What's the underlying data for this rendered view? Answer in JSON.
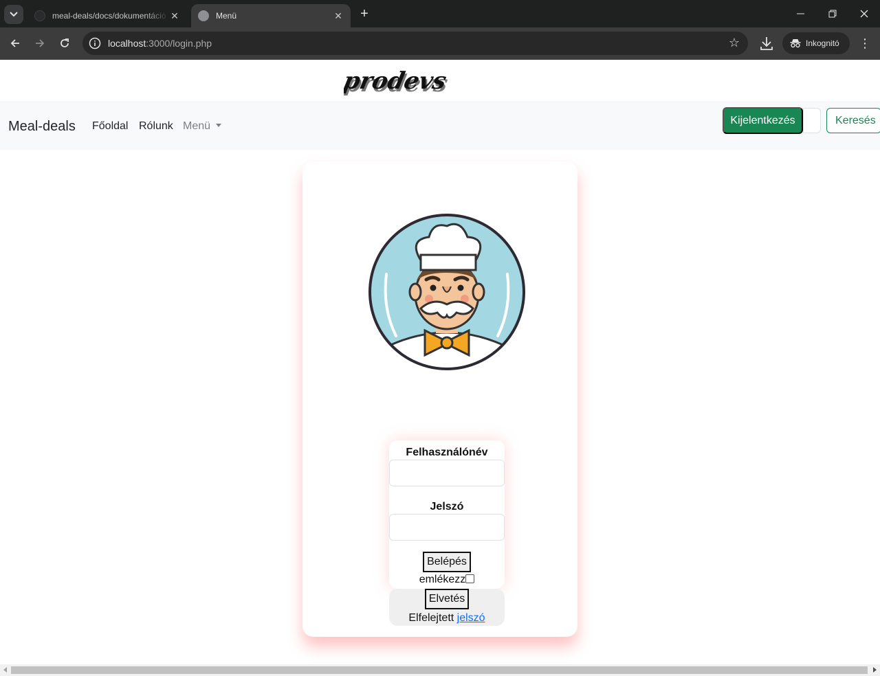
{
  "browser": {
    "tabs": [
      {
        "title": "meal-deals/docs/dokumentáció",
        "active": false,
        "close": "✕"
      },
      {
        "title": "Menü",
        "active": true,
        "close": "✕"
      }
    ],
    "new_tab": "+",
    "window_controls": {
      "minimize": "—",
      "restore": "❐",
      "close": "✕"
    },
    "address": {
      "host": "localhost",
      "path": ":3000/login.php"
    },
    "incognito_label": "Inkognitó",
    "icons": [
      "tab-list-icon",
      "back-icon",
      "forward-icon",
      "reload-icon",
      "site-info-icon",
      "bookmark-star-icon",
      "download-icon",
      "incognito-icon",
      "menu-kebab-icon"
    ]
  },
  "page": {
    "logo_text": "prodevs",
    "navbar": {
      "brand": "Meal-deals",
      "links": [
        "Főoldal",
        "Rólunk"
      ],
      "dropdown_label": "Menü",
      "logout_label": "Kijelentkezés",
      "search_value": "",
      "search_label": "Keresés"
    },
    "login": {
      "username_label": "Felhasználónév",
      "username_value": "",
      "password_label": "Jelszó",
      "password_value": "",
      "submit_label": "Belépés",
      "remember_label": "emlékezz",
      "remember_checked": false,
      "reset_label": "Elvetés",
      "forgot_text": "Elfelejtett",
      "forgot_link": "jelszó"
    }
  },
  "colors": {
    "success": "#198754",
    "link": "#0d6efd",
    "navbar_bg": "#f8f9fa",
    "chrome_dark": "#1f2020",
    "chrome_toolbar": "#3c3c3c"
  }
}
